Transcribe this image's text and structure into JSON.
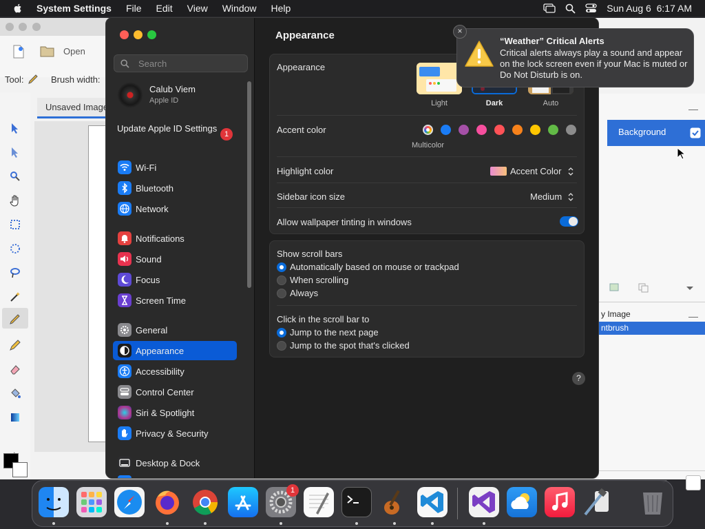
{
  "menubar": {
    "app_name": "System Settings",
    "menus": [
      "File",
      "Edit",
      "View",
      "Window",
      "Help"
    ],
    "clock": "Sun Aug 6  6:17 AM"
  },
  "background_app": {
    "open_label": "Open",
    "tool_label": "Tool:",
    "brush_width_label": "Brush width:",
    "tab_label": "Unsaved Image",
    "layer_name": "Background",
    "history": [
      "y Image",
      "ntbrush"
    ]
  },
  "settings": {
    "search_placeholder": "Search",
    "account": {
      "name": "Calub Viem",
      "subtitle": "Apple ID"
    },
    "update": {
      "label": "Update Apple ID Settings",
      "badge": "1"
    },
    "sidebar": [
      {
        "label": "Wi-Fi",
        "icon": "wifi-icon",
        "color": "#1a7cf5"
      },
      {
        "label": "Bluetooth",
        "icon": "bluetooth-icon",
        "color": "#1a7cf5"
      },
      {
        "label": "Network",
        "icon": "globe-icon",
        "color": "#1a7cf5"
      },
      {
        "label": "Notifications",
        "icon": "bell-icon",
        "color": "#e5413f"
      },
      {
        "label": "Sound",
        "icon": "speaker-icon",
        "color": "#e8334f"
      },
      {
        "label": "Focus",
        "icon": "moon-icon",
        "color": "#5e4ad6"
      },
      {
        "label": "Screen Time",
        "icon": "hourglass-icon",
        "color": "#6a3fd0"
      },
      {
        "label": "General",
        "icon": "gear-icon",
        "color": "#8a8a8e"
      },
      {
        "label": "Appearance",
        "icon": "appearance-icon",
        "color": "#1c1c1c"
      },
      {
        "label": "Accessibility",
        "icon": "accessibility-icon",
        "color": "#1a7cf5"
      },
      {
        "label": "Control Center",
        "icon": "control-center-icon",
        "color": "#8a8a8e"
      },
      {
        "label": "Siri & Spotlight",
        "icon": "siri-icon",
        "color": "#b0388f"
      },
      {
        "label": "Privacy & Security",
        "icon": "hand-icon",
        "color": "#1a7cf5"
      },
      {
        "label": "Desktop & Dock",
        "icon": "dock-icon",
        "color": "#2c2c2e"
      }
    ],
    "selected": "Appearance",
    "page_title": "Appearance",
    "appearance": {
      "label": "Appearance",
      "options": [
        "Light",
        "Dark",
        "Auto"
      ],
      "selected": "Dark"
    },
    "accent": {
      "label": "Accent color",
      "caption": "Multicolor",
      "colors": [
        "#1a7cf5",
        "#a550a7",
        "#f74f9e",
        "#ff5257",
        "#f7821b",
        "#ffc600",
        "#62ba46",
        "#8c8c8c"
      ]
    },
    "highlight": {
      "label": "Highlight color",
      "value": "Accent Color"
    },
    "icon_size": {
      "label": "Sidebar icon size",
      "value": "Medium"
    },
    "tinting": {
      "label": "Allow wallpaper tinting in windows",
      "enabled": true
    },
    "scroll_bars": {
      "label": "Show scroll bars",
      "options": [
        "Automatically based on mouse or trackpad",
        "When scrolling",
        "Always"
      ],
      "selected": "Automatically based on mouse or trackpad"
    },
    "click_scroll": {
      "label": "Click in the scroll bar to",
      "options": [
        "Jump to the next page",
        "Jump to the spot that's clicked"
      ],
      "selected": "Jump to the next page"
    },
    "help_label": "?"
  },
  "notification": {
    "close_label": "×",
    "title": "“Weather” Critical Alerts",
    "body": "Critical alerts always play a sound and appear on the lock screen even if your Mac is muted or Do Not Disturb is on."
  },
  "dock": {
    "apps": [
      "Finder",
      "Launchpad",
      "Safari",
      "Firefox",
      "Chrome",
      "App Store",
      "System Settings",
      "TextEdit",
      "Terminal",
      "GarageBand",
      "Visual Studio Code",
      "Visual Studio",
      "Weather",
      "Music",
      "Xcode",
      "Trash"
    ],
    "settings_badge": "1"
  }
}
